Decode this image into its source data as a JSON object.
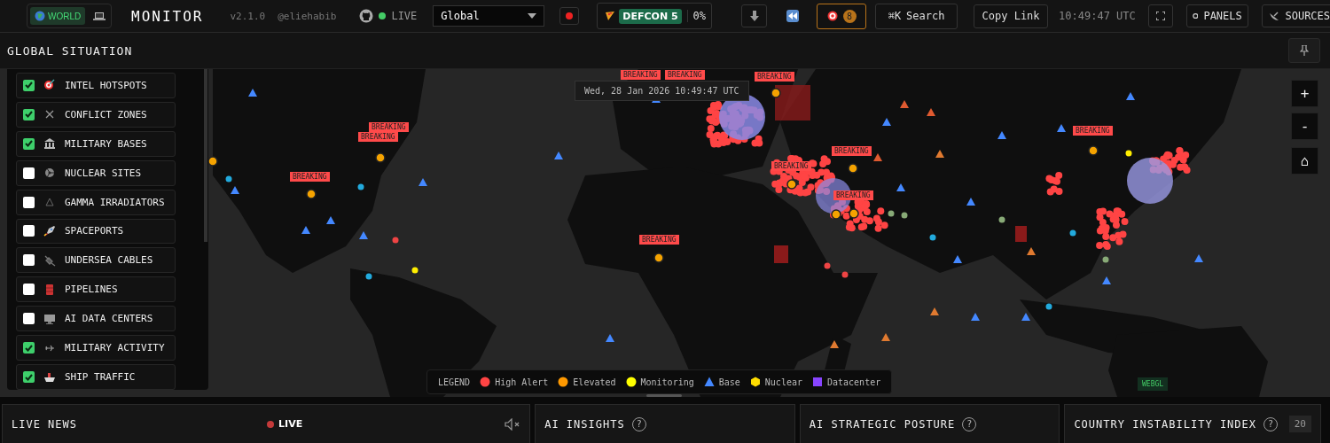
{
  "header": {
    "view_toggle": [
      {
        "label": "WORLD",
        "selected": true
      },
      {
        "selected": false
      }
    ],
    "title": "MONITOR",
    "version": "v2.1.0",
    "author": "@eliehabib",
    "status": "LIVE",
    "region_select": {
      "value": "Global"
    },
    "defcon": {
      "label": "DEFCON 5",
      "value": "0%"
    },
    "alerts_count": "8",
    "search": {
      "shortcut": "⌘K",
      "label": "Search"
    },
    "copy_link": "Copy Link",
    "clock": "10:49:47 UTC",
    "panels_button": "PANELS",
    "sources_button": "SOURCES"
  },
  "map_panel": {
    "title": "GLOBAL SITUATION",
    "layers": [
      {
        "label": "INTEL HOTSPOTS",
        "checked": true
      },
      {
        "label": "CONFLICT ZONES",
        "checked": true
      },
      {
        "label": "MILITARY BASES",
        "checked": true
      },
      {
        "label": "NUCLEAR SITES",
        "checked": false
      },
      {
        "label": "GAMMA IRRADIATORS",
        "checked": false
      },
      {
        "label": "SPACEPORTS",
        "checked": false
      },
      {
        "label": "UNDERSEA CABLES",
        "checked": false
      },
      {
        "label": "PIPELINES",
        "checked": false
      },
      {
        "label": "AI DATA CENTERS",
        "checked": false
      },
      {
        "label": "MILITARY ACTIVITY",
        "checked": true
      },
      {
        "label": "SHIP TRAFFIC",
        "checked": true
      }
    ],
    "timestamp": "Wed, 28 Jan 2026 10:49:47 UTC",
    "breaking_labels": [
      "BREAKING",
      "BREAKING",
      "BREAKING",
      "BREAKING",
      "BREAKING",
      "BREAKING",
      "BREAKING",
      "BREAKING",
      "BREAKING",
      "BREAKING",
      "BREAKING"
    ],
    "zoom_controls": [
      "+",
      "-",
      "⌂"
    ],
    "legend": {
      "title": "LEGEND",
      "items": [
        {
          "label": "High Alert",
          "kind": "circle",
          "color": "#ff4444"
        },
        {
          "label": "Elevated",
          "kind": "circle",
          "color": "#ff9900"
        },
        {
          "label": "Monitoring",
          "kind": "circle",
          "color": "#ffff00"
        },
        {
          "label": "Base",
          "kind": "triangle",
          "color": "#4488ff"
        },
        {
          "label": "Nuclear",
          "kind": "hexagon",
          "color": "#ffdd00"
        },
        {
          "label": "Datacenter",
          "kind": "square",
          "color": "#8844ff"
        }
      ]
    },
    "renderer": "WEBGL"
  },
  "panels": [
    {
      "title": "LIVE NEWS",
      "live": "LIVE"
    },
    {
      "title": "AI INSIGHTS",
      "help": "?"
    },
    {
      "title": "AI STRATEGIC POSTURE",
      "help": "?"
    },
    {
      "title": "COUNTRY INSTABILITY INDEX",
      "help": "?",
      "count": "20"
    }
  ]
}
